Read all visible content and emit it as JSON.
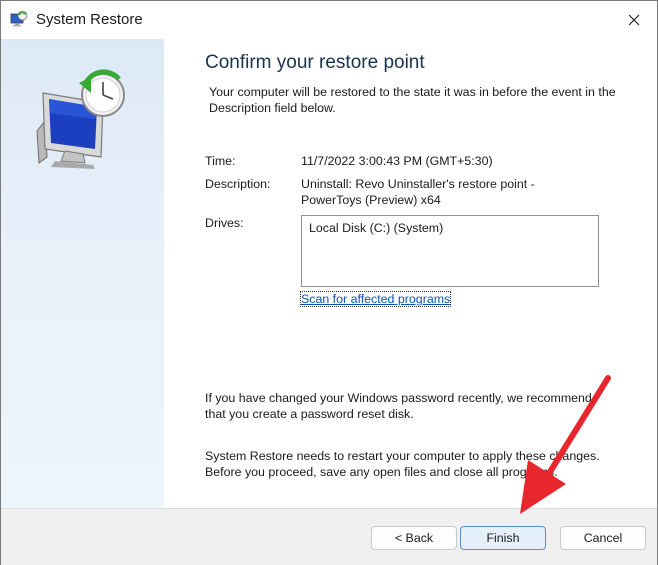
{
  "window": {
    "title": "System Restore",
    "icon": "system-restore-icon",
    "close_icon": "close-icon"
  },
  "main": {
    "heading": "Confirm your restore point",
    "intro": "Your computer will be restored to the state it was in before the event in the Description field below.",
    "time_label": "Time:",
    "time_value": "11/7/2022 3:00:43 PM (GMT+5:30)",
    "description_label": "Description:",
    "description_line1": "Uninstall: Revo Uninstaller's restore point -",
    "description_line2": "PowerToys (Preview) x64",
    "drives_label": "Drives:",
    "drives": [
      "Local Disk (C:) (System)"
    ],
    "scan_link": "Scan for affected programs",
    "password_note_line1": "If you have changed your Windows password recently, we recommend",
    "password_note_line2": "that you create a password reset disk.",
    "restart_note_line1": "System Restore needs to restart your computer to apply these changes.",
    "restart_note_line2": "Before you proceed, save any open files and close all programs."
  },
  "footer": {
    "back_label": "< Back",
    "finish_label": "Finish",
    "cancel_label": "Cancel"
  },
  "annotation": {
    "arrow_color": "#e8262d",
    "arrow_icon": "red-arrow-icon"
  },
  "colors": {
    "heading": "#1a3350",
    "link": "#0a55b5",
    "accent_border": "#5b8dd1",
    "sidebar": "#dde9f6"
  }
}
